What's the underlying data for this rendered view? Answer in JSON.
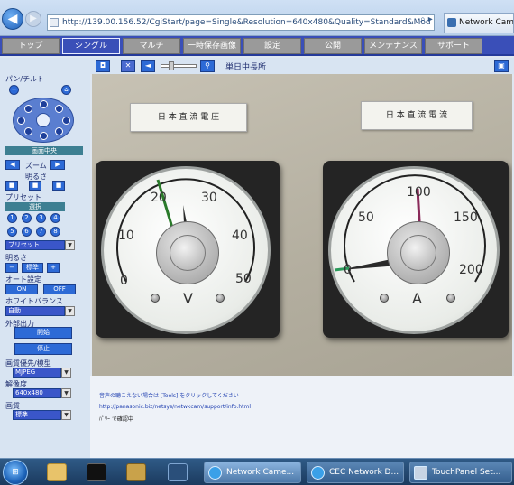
{
  "browser": {
    "address": "http://139.00.156.52/CgiStart/page=Single&Resolution=640x480&Quality=Standard&Mod",
    "tab_title": "Network Came"
  },
  "nav": {
    "items": [
      "トップ",
      "シングル",
      "マルチ",
      "一時保存画像",
      "設定",
      "公開",
      "メンテナンス",
      "サポート"
    ],
    "active_index": 1
  },
  "left_panel": {
    "pan_tilt_label": "パン/チルト",
    "brightness_label": "明るさ",
    "zoom_label": "ズーム",
    "preset_label": "プリセット",
    "preset_bar": "選択",
    "preset_numbers": [
      "1",
      "2",
      "3",
      "4",
      "5",
      "6",
      "7",
      "8"
    ],
    "preset_select": "プリセット",
    "auto_focus_label": "明るさ",
    "standard_label": "標準",
    "auto_mode_label": "オート設定",
    "on_label": "ON",
    "off_label": "OFF",
    "white_balance_label": "ホワイトバランス",
    "white_balance_value": "自動",
    "recording_label": "外部出力",
    "start_button": "開始",
    "stop_button": "停止",
    "quality_label": "画質優先/模型",
    "quality_value": "MJPEG",
    "resolution_label": "解像度",
    "resolution_value": "640x480",
    "image_label": "画質",
    "image_value": "標準",
    "center_label": "画面中央"
  },
  "video_toolbar": {
    "label": "単日中長所"
  },
  "camera": {
    "left_plate": "日 本 直 流 電 圧",
    "right_plate": "日 本 直 流 電 流",
    "left_scale": [
      "0",
      "10",
      "20",
      "30",
      "40",
      "50"
    ],
    "left_unit": "V",
    "right_scale": [
      "0",
      "50",
      "100",
      "150",
      "200"
    ],
    "right_unit": "A"
  },
  "content": {
    "line1": "音声の聴こえない場合は [Tools] をクリックしてください",
    "line2": "http://panasonic.biz/netsys/netwkcam/support/info.html",
    "line3": "ﾊﾟﾜｰ で確認中"
  },
  "taskbar": {
    "buttons": [
      "Network Came...",
      "CEC Network D...",
      "TouchPanel Set..."
    ],
    "active_index": 0
  }
}
